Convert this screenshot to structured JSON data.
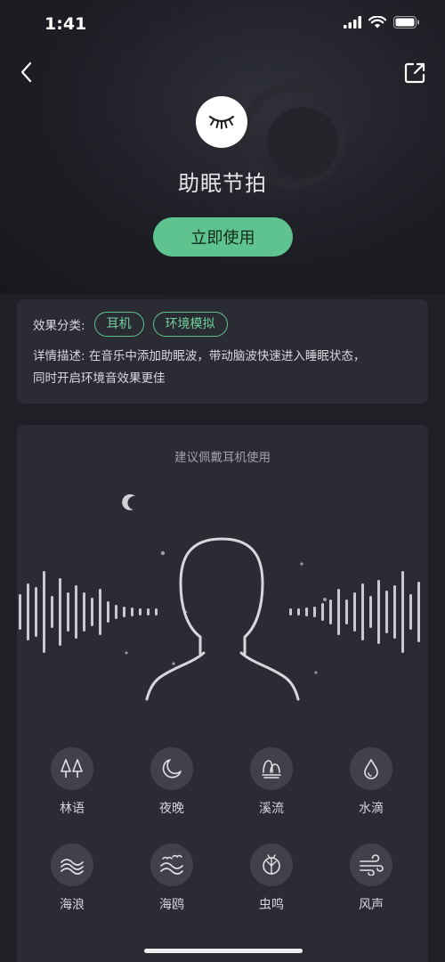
{
  "status_bar": {
    "time": "1:41"
  },
  "hero": {
    "title": "助眠节拍",
    "use_button": "立即使用"
  },
  "info": {
    "category_label": "效果分类:",
    "tags": [
      "耳机",
      "环境模拟"
    ],
    "description_label": "详情描述:",
    "description_line1": "在音乐中添加助眠波，带动脑波快速进入睡眠状态，",
    "description_line2": "同时开启环境音效果更佳"
  },
  "main": {
    "hint": "建议佩戴耳机使用"
  },
  "sounds": [
    {
      "label": "林语",
      "icon": "forest-icon"
    },
    {
      "label": "夜晚",
      "icon": "moon-icon"
    },
    {
      "label": "溪流",
      "icon": "stream-icon"
    },
    {
      "label": "水滴",
      "icon": "water-drop-icon"
    },
    {
      "label": "海浪",
      "icon": "wave-icon"
    },
    {
      "label": "海鸥",
      "icon": "seagull-icon"
    },
    {
      "label": "虫鸣",
      "icon": "insect-icon"
    },
    {
      "label": "风声",
      "icon": "wind-icon"
    }
  ],
  "colors": {
    "accent": "#5fc38f",
    "card": "#2b2c33",
    "background": "#1f2026"
  }
}
